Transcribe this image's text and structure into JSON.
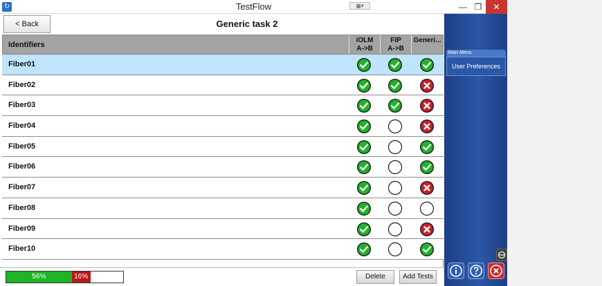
{
  "window": {
    "title": "TestFlow",
    "mini_control": "▦▾"
  },
  "header": {
    "back_label": "< Back",
    "title": "Generic task 2"
  },
  "table": {
    "columns": [
      {
        "line1": "Identifiers",
        "line2": ""
      },
      {
        "line1": "iOLM",
        "line2": "A->B"
      },
      {
        "line1": "FIP",
        "line2": "A->B"
      },
      {
        "line1": "Generi...",
        "line2": ""
      }
    ],
    "rows": [
      {
        "label": "Fiber01",
        "status": [
          "pass",
          "pass",
          "pass"
        ],
        "selected": true
      },
      {
        "label": "Fiber02",
        "status": [
          "pass",
          "pass",
          "fail"
        ]
      },
      {
        "label": "Fiber03",
        "status": [
          "pass",
          "pass",
          "fail"
        ]
      },
      {
        "label": "Fiber04",
        "status": [
          "pass",
          "empty",
          "fail"
        ]
      },
      {
        "label": "Fiber05",
        "status": [
          "pass",
          "empty",
          "pass"
        ]
      },
      {
        "label": "Fiber06",
        "status": [
          "pass",
          "empty",
          "pass"
        ]
      },
      {
        "label": "Fiber07",
        "status": [
          "pass",
          "empty",
          "fail"
        ]
      },
      {
        "label": "Fiber08",
        "status": [
          "pass",
          "empty",
          "empty"
        ]
      },
      {
        "label": "Fiber09",
        "status": [
          "pass",
          "empty",
          "fail"
        ]
      },
      {
        "label": "Fiber10",
        "status": [
          "pass",
          "empty",
          "pass"
        ]
      }
    ]
  },
  "footer": {
    "progress_pass_percent": 56,
    "progress_pass_label": "56%",
    "progress_fail_percent": 16,
    "progress_fail_label": "16%",
    "delete_label": "Delete",
    "add_tests_label": "Add Tests"
  },
  "side_panel": {
    "menu_header": "Main Menu",
    "menu_item": "User Preferences",
    "buttons": [
      "info-icon",
      "help-icon",
      "close-icon"
    ]
  },
  "colors": {
    "pass": "#1fb328",
    "fail": "#c8202a",
    "selected_row": "#bfe4fb",
    "panel": "#2b57a6"
  }
}
